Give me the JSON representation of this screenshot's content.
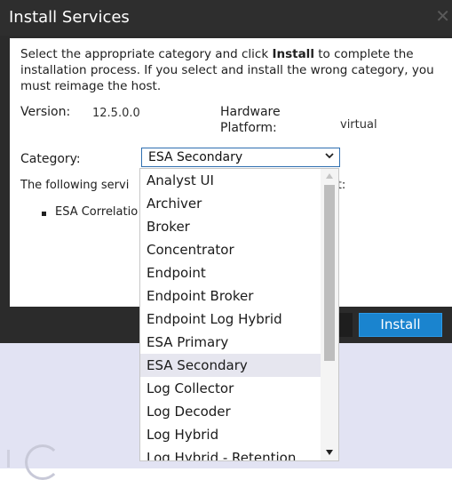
{
  "dialog": {
    "title": "Install Services",
    "intro_part1": "Select the appropriate category and click ",
    "intro_bold": "Install",
    "intro_part2": " to complete the installation process. If you select and install the wrong category, you must reimage the host.",
    "version_label": "Version:",
    "version_value": "12.5.0.0",
    "hardware_label": "Hardware Platform:",
    "hardware_value": "virtual",
    "category_label": "Category:",
    "category_selected": "ESA Secondary",
    "following_text": "The following servi",
    "following_tail": "st:",
    "bullet_text": "ESA Correlatio",
    "install_label": "Install"
  },
  "dropdown": {
    "options": [
      "Analyst UI",
      "Archiver",
      "Broker",
      "Concentrator",
      "Endpoint",
      "Endpoint Broker",
      "Endpoint Log Hybrid",
      "ESA Primary",
      "ESA Secondary",
      "Log Collector",
      "Log Decoder",
      "Log Hybrid",
      "Log Hybrid - Retention"
    ],
    "selected_index": 8
  },
  "colors": {
    "header_bg": "#2e2e2e",
    "accent": "#1a84cf",
    "select_border": "#2f6fb0"
  }
}
